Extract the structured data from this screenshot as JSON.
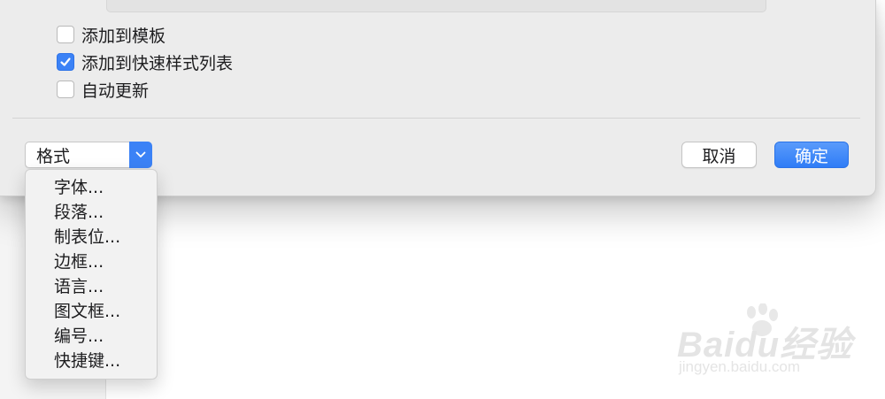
{
  "options": [
    {
      "label": "添加到模板",
      "checked": false
    },
    {
      "label": "添加到快速样式列表",
      "checked": true
    },
    {
      "label": "自动更新",
      "checked": false
    }
  ],
  "format_popup": {
    "label": "格式"
  },
  "buttons": {
    "cancel": "取消",
    "ok": "确定"
  },
  "format_menu": {
    "items": [
      "字体...",
      "段落...",
      "制表位...",
      "边框...",
      "语言...",
      "图文框...",
      "编号...",
      "快捷键..."
    ]
  },
  "watermark": {
    "logo": "Baidu经验",
    "url": "jingyen.baidu.com"
  },
  "colors": {
    "accent": "#3b82f6",
    "dialog_bg": "#ececec"
  }
}
